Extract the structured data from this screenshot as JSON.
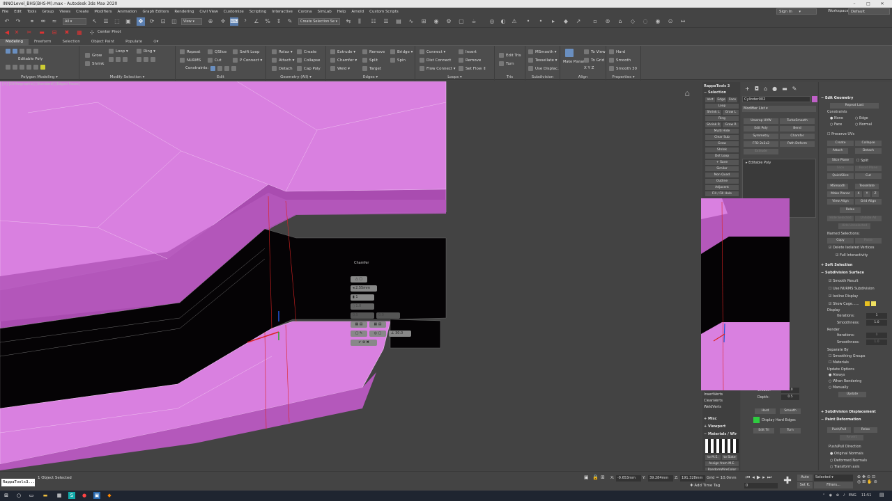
{
  "window": {
    "title": "INNOLevel_BHS(BHS-M).max - Autodesk 3ds Max 2020"
  },
  "menu": [
    "File",
    "Edit",
    "Tools",
    "Group",
    "Views",
    "Create",
    "Modifiers",
    "Animation",
    "Graph Editors",
    "Rendering",
    "Civil View",
    "Customize",
    "Scripting",
    "Interactive",
    "Corona",
    "SimLab",
    "Help",
    "Arnold",
    "Custom Scripts"
  ],
  "account": {
    "sign_in": "Sign In",
    "workspaces_label": "Workspaces:",
    "workspace_value": "Default"
  },
  "toolbar": {
    "filter": "All",
    "view": "View",
    "selection_set": "Create Selection Se",
    "center_pivot": "Center Pivot"
  },
  "ribbon": {
    "tabs": [
      "Modeling",
      "Freeform",
      "Selection",
      "Object Paint",
      "Populate"
    ],
    "polygon_modeling": "Polygon Modeling",
    "editable_poly": "Editable Poly",
    "modify_selection": {
      "label": "Modify Selection",
      "grow": "Grow",
      "shrink": "Shrink",
      "loop": "Loop",
      "ring": "Ring"
    },
    "edit": {
      "label": "Edit",
      "repeat": "Repeat",
      "qslice": "QSlice",
      "swift_loop": "Swift Loop",
      "nurms": "NURMS",
      "cut": "Cut",
      "p_connect": "P Connect",
      "constraints": "Constraints:"
    },
    "geometry": {
      "label": "Geometry (All)",
      "relax": "Relax",
      "create": "Create",
      "attach": "Attach",
      "collapse": "Collapse",
      "detach": "Detach",
      "cap_poly": "Cap Poly"
    },
    "edges": {
      "label": "Edges",
      "extrude": "Extrude",
      "remove": "Remove",
      "bridge": "Bridge",
      "chamfer": "Chamfer",
      "split": "Split",
      "spin": "Spin",
      "weld": "Weld",
      "target": "Target"
    },
    "loops": {
      "label": "Loops",
      "connect": "Connect",
      "insert": "Insert",
      "dist_connect": "Dist Connect",
      "remove": "Remove",
      "flow_connect": "Flow Connect",
      "set_flow": "Set Flow"
    },
    "tris": {
      "label": "Tris",
      "edit_tris": "Edit Tris",
      "turn": "Turn"
    },
    "subdivision": {
      "label": "Subdivision",
      "msmooth": "MSmooth",
      "tessellate": "Tessellate",
      "use_displac": "Use Displac."
    },
    "align": {
      "label": "Align",
      "make_planar": "Make Planar",
      "to_view": "To View",
      "to_grid": "To Grid",
      "xyz": "X  Y  Z"
    },
    "properties": {
      "label": "Properties",
      "hard": "Hard",
      "smooth": "Smooth",
      "smooth30": "Smooth 30"
    }
  },
  "viewport": {
    "label": "[+] [Orthographic] [Standard] [Edged Faces]",
    "caddy": {
      "title": "Chamfer",
      "amount": "2.55mm",
      "segments": "1",
      "tension": "1.0",
      "field4": "0.5",
      "field5": "0.0",
      "angle": "30.0"
    }
  },
  "rappatools": {
    "title": "RappaTools 3",
    "selection": "Selection",
    "modes": [
      "Vert",
      "Edge",
      "Face"
    ],
    "buttons": [
      "Loop",
      "Shrink L",
      "Grow L",
      "Ring",
      "Shrink R",
      "Grow R",
      "Multi Hide",
      "Clear Sub",
      "Grow",
      "Shrink",
      "Dot Loop",
      "+ Save",
      "Similar",
      "Non Quad",
      "Outline",
      "Adjacent",
      "Fill / Fill Hole"
    ],
    "insert_verts": "InsertVerts",
    "cleanverts": "CleanVerts",
    "weldverts": "WeldVerts",
    "misc": "Misc",
    "viewport": "Viewport",
    "materials": "Materials / Wir",
    "to_me": "to M.E.",
    "to_slate": "to Slate",
    "assign_me": "Assign from M.E.",
    "random_wire": "RandomWireColor",
    "status": "RappaTools3..."
  },
  "command_panel": {
    "object_name": "Cylinder002",
    "modifier_list": "Modifier List",
    "buttons": [
      "Unwrap UVW",
      "TurboSmooth",
      "Edit Poly",
      "Bend",
      "Symmetry",
      "Chamfer",
      "FFD 2x2x2",
      "Path Deform",
      "Extrude"
    ],
    "stack_item": "Editable Poly",
    "crease": "Crease:",
    "crease_val": "0.0",
    "depth": "Depth:",
    "depth_val": "0.5",
    "hard": "Hard",
    "smooth": "Smooth",
    "display_hard_edges": "Display Hard Edges",
    "edit_tri": "Edit Tri",
    "turn": "Turn"
  },
  "edit_geometry": {
    "title": "Edit Geometry",
    "repeat_last": "Repeat Last",
    "constraints": "Constraints",
    "none": "None",
    "edge": "Edge",
    "face": "Face",
    "normal": "Normal",
    "preserve_uvs": "Preserve UVs",
    "create": "Create",
    "collapse": "Collapse",
    "attach": "Attach",
    "detach": "Detach",
    "slice_plane": "Slice Plane",
    "split": "Split",
    "slice": "Slice",
    "reset_plane": "Reset Plane",
    "quickslice": "QuickSlice",
    "cut": "Cut",
    "msmooth": "MSmooth",
    "tessellate": "Tessellate",
    "make_planar": "Make Planar",
    "x": "X",
    "y": "Y",
    "z": "Z",
    "view_align": "View Align",
    "grid_align": "Grid Align",
    "relax": "Relax",
    "hide_selected": "Hide Selected",
    "unhide_all": "Unhide All",
    "hide_unselected": "Hide Unselected",
    "named_selections": "Named Selections:",
    "copy": "Copy",
    "paste": "Paste",
    "delete_isolated": "Delete Isolated Vertices",
    "full_interactivity": "Full Interactivity",
    "soft_selection": "Soft Selection",
    "subdivision_surface": "Subdivision Surface",
    "smooth_result": "Smooth Result",
    "use_nurms": "Use NURMS Subdivision",
    "isoline_display": "Isoline Display",
    "show_cage": "Show Cage......",
    "display": "Display",
    "iterations": "Iterations:",
    "iter_val": "1",
    "smoothness": "Smoothness:",
    "smooth_val": "1.0",
    "render": "Render",
    "r_iter_val": "0",
    "r_smooth_val": "1.0",
    "separate_by": "Separate By",
    "smoothing_groups": "Smoothing Groups",
    "materials": "Materials",
    "update_options": "Update Options",
    "always": "Always",
    "when_rendering": "When Rendering",
    "manually": "Manually",
    "update": "Update",
    "subdivision_displacement": "Subdivision Displacement",
    "paint_deformation": "Paint Deformation",
    "push_pull": "Push/Pull",
    "relax2": "Relax",
    "revert": "Revert",
    "push_pull_direction": "Push/Pull Direction",
    "original_normals": "Original Normals",
    "deformed_normals": "Deformed Normals",
    "transform_axis": "Transform axis"
  },
  "status": {
    "maxscript": "RappaTools3...",
    "selected": "1 Object Selected",
    "x_label": "X:",
    "x": "-9.653mm",
    "y_label": "Y:",
    "y": "39.284mm",
    "z_label": "Z:",
    "z": "191.328mm",
    "grid": "Grid = 10.0mm",
    "add_time_tag": "Add Time Tag",
    "auto": "Auto",
    "selected_dd": "Selected",
    "set_k": "Set K.",
    "filters": "Filters...",
    "frame": "0"
  },
  "taskbar": {
    "lang": "ENG",
    "time": "11:51"
  }
}
